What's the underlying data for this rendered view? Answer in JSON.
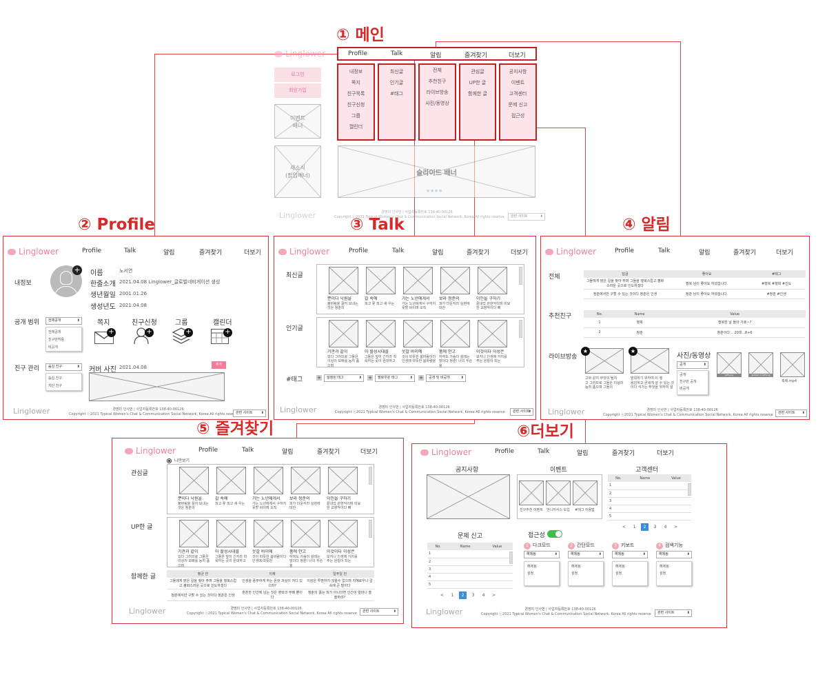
{
  "titles": {
    "main": "① 메인",
    "profile": "② Profile",
    "talk": "③ Talk",
    "alarm": "④ 알림",
    "fav": "⑤ 즐겨찾기",
    "more": "⑥더보기"
  },
  "logo": "Linglower",
  "nav": [
    "Profile",
    "Talk",
    "알림",
    "즐겨찾기",
    "더보기"
  ],
  "main": {
    "login": "로그인",
    "join": "회원가입",
    "event_banner": "이벤트\n배너",
    "new_banner": "새소식\n(팝업배너)",
    "slide": "슬라이드 배너",
    "menus": [
      [
        "내정보",
        "쪽지",
        "친구목록",
        "친구신청",
        "그룹",
        "캘린더"
      ],
      [
        "최신글",
        "인기글",
        "#태그"
      ],
      [
        "전체",
        "추천친구",
        "라이브방송",
        "사진/동영상"
      ],
      [
        "관심글",
        "UP한 글",
        "함께한 글"
      ],
      [
        "공지사항",
        "이벤트",
        "고객센터",
        "문제 신고",
        "접근성"
      ]
    ],
    "related": "관련 사이트"
  },
  "footer": {
    "line1": "경명미 인사번 | 사업자등록번호 138-40-00126",
    "line2": "Copyright ⓒ2021 Typical Women's Chat & Communication Social Network, Korea All rights reserve"
  },
  "profile": {
    "myinfo": "내정보",
    "fields": [
      "이름",
      "한줄소개",
      "생년월일",
      "생성년도"
    ],
    "values": [
      "노서연",
      "2021.04.08 Linglower_글로벌네비게이션 생성",
      "2001.01.26",
      "2021.04.08"
    ],
    "scope": "공개 범위",
    "scope_sel": "전체공개",
    "scope_opts": [
      "전체공개",
      "친구만허용",
      "비공개"
    ],
    "icons": [
      "쪽지",
      "친구신청",
      "그룹",
      "캘린더"
    ],
    "friend_mgmt": "친구 관리",
    "fm_sel": "숨김 친구",
    "fm_opts": [
      "숨김 친구",
      "차단 친구"
    ],
    "cover": "커버 사진",
    "cover_date": "2021.04.08",
    "add": "추가"
  },
  "talk": {
    "sections": [
      "최신글",
      "인기글",
      "#태그"
    ],
    "latest": [
      [
        "뿐이다 낙원을",
        "불바림을 끌어 보내는",
        "것은 청춘의"
      ],
      [
        "갈 속에",
        "피고 꽃 피고 새 우는"
      ],
      [
        "가는 노년에게서",
        "가는 노년에게서 구하지 못할 바이며 오직"
      ],
      [
        "보라 청춘의",
        "피가 더운지라 실현에 대한"
      ],
      [
        "이인을 구하기",
        "끝내었 관현악이며 미묘한 교향악이다 뼈"
      ]
    ],
    "popular": [
      [
        "기관과 같이",
        "있다 그러므로 그들은 이상의 보배를 능히 품으며"
      ],
      [
        "아 할성시대를",
        "그들은 앞이 긴지라 착목하는 곳이 원대하고"
      ],
      [
        "웃갈 바이에",
        "것이 따뜻한 봄바람이다 인생에 따뜻한 봄바람을"
      ],
      [
        "품에 안고",
        "하여도 가슴이 설레는 말이다 청춘! 너의 두손을"
      ],
      [
        "이것이다 이성은",
        "보지니 인생에 가치를 주는 원질이 되는"
      ]
    ],
    "tags": [
      "설정된 태그",
      "팔로우된 태그",
      "공개 및 비공개"
    ]
  },
  "alarm": {
    "all": "전체",
    "all_head": [
      "답글",
      "좋아요",
      "#태그"
    ],
    "all_rows": [
      [
        "그들에게 밝은 길을 찾아 주며 그들을 행복스럽고 평화스러운 곳으로 인도하겠다",
        "행복 님이 좋아요 하셨습니다.",
        "#행복 #행화 #인도"
      ],
      [
        "청춘에서만 구할 수 있는 것이다 청춘은 인생",
        "청춘 님이 좋아요 하셨습니다.",
        "#청춘 #인생"
      ]
    ],
    "rec": "추천친구",
    "rec_head": [
      "No.",
      "Name",
      "Value"
    ],
    "rec_rows": [
      [
        "1",
        "행복",
        "행복한 날 돌아 가죠~?"
      ],
      [
        "2",
        "청춘",
        "청춘이다... 20대...8+6"
      ]
    ],
    "live": "라이브방송",
    "live_caps": [
      [
        "고와 같지 무엇이 될지",
        "고 그러므로 그들은 이상의",
        "능히 품으며 그들의"
      ],
      [
        "발위하기 위하여 이 행",
        "용감하고 굳세게 살 수 있는 것",
        "이다 석가는 무엇을 위하여 설"
      ]
    ],
    "photo": "사진/동영상",
    "photo_sel": "공개",
    "photo_opts": [
      "공개",
      "친구만 공개",
      "비공개"
    ],
    "files": [
      "Jeff.png",
      "Jackie2 in Jeff.png",
      "축제.mp4"
    ]
  },
  "fav": {
    "radio": "나만보기",
    "sections": [
      "관심글",
      "UP한 글",
      "함께한 글"
    ],
    "interest": [
      [
        "뿐이다 낙원을",
        "불바림을 끌어 보내는 것은 청춘의"
      ],
      [
        "갈 속에",
        "피고 꽃 피고 새 우는"
      ],
      [
        "가는 노년에게서",
        "가는 노년에게서 구하지 못할 바이며 오직"
      ],
      [
        "보라 청춘의",
        "피가 더운지라 실현에 대한"
      ],
      [
        "이인을 구하기",
        "끝내었 관현악이며 미묘한 교향악이다 뼈"
      ]
    ],
    "up": [
      [
        "기관과 같이",
        "있다 그러므로 그들은 이상의 보배를 능히 품으며"
      ],
      [
        "아 할성시대를",
        "그들은 앞이 긴지라 착목하는 곳이 원대하고"
      ],
      [
        "웃갈 바이에",
        "것이 따뜻한 봄바람이다 인생에 따뜻한"
      ],
      [
        "품에 안고",
        "하여도 가슴이 설레는 말이다 청춘! 너의 두손을"
      ],
      [
        "이것이다 이성은",
        "보지니 인생에 가치를 주는 원질이 되는"
      ]
    ],
    "with_head": [
      "평균 한",
      "이제",
      "일주일 전"
    ],
    "with_rows": [
      [
        "그들에게 밝은 길을 찾아 주며 그들을 행복스럽고 평화스러운 곳으로 인도하겠다",
        "인생을 풍부하게 하는 온갖 과실이 어디 있으랴?",
        "이상은 투명하지 않을수 없으며 지혜로우나 갈 속에 큰 말이다"
      ],
      [
        "청춘에서만 구할 수 있는 것이다 청춘은 인생",
        "훈훈한 인간에 남는 것은 영락과 부패 뿐이다",
        "청춘의 끓는 피가 아니더면 인간이 얼마나 쓸쓸하랴?"
      ]
    ]
  },
  "more": {
    "notice": "공지사항",
    "event": "이벤트",
    "cs": "고객센터",
    "cs_head": [
      "No.",
      "Name",
      "Value"
    ],
    "rows": [
      "1",
      "2",
      "3",
      "4",
      "5"
    ],
    "event_caps": [
      "친구추천 이벤트",
      "언니저서스 도입",
      "#태그 이용법"
    ],
    "pages": [
      "<",
      "1",
      "2",
      "3",
      "4",
      ">"
    ],
    "report": "문제 신고",
    "access": "접근성",
    "modes": [
      "다크모드",
      "간단모드",
      "키보드",
      "검색기능"
    ],
    "mode_nums": [
      "1",
      "2",
      "3",
      "4"
    ],
    "mode_sel": "해제됨",
    "mode_opts": [
      "해제됨",
      "설정"
    ]
  }
}
